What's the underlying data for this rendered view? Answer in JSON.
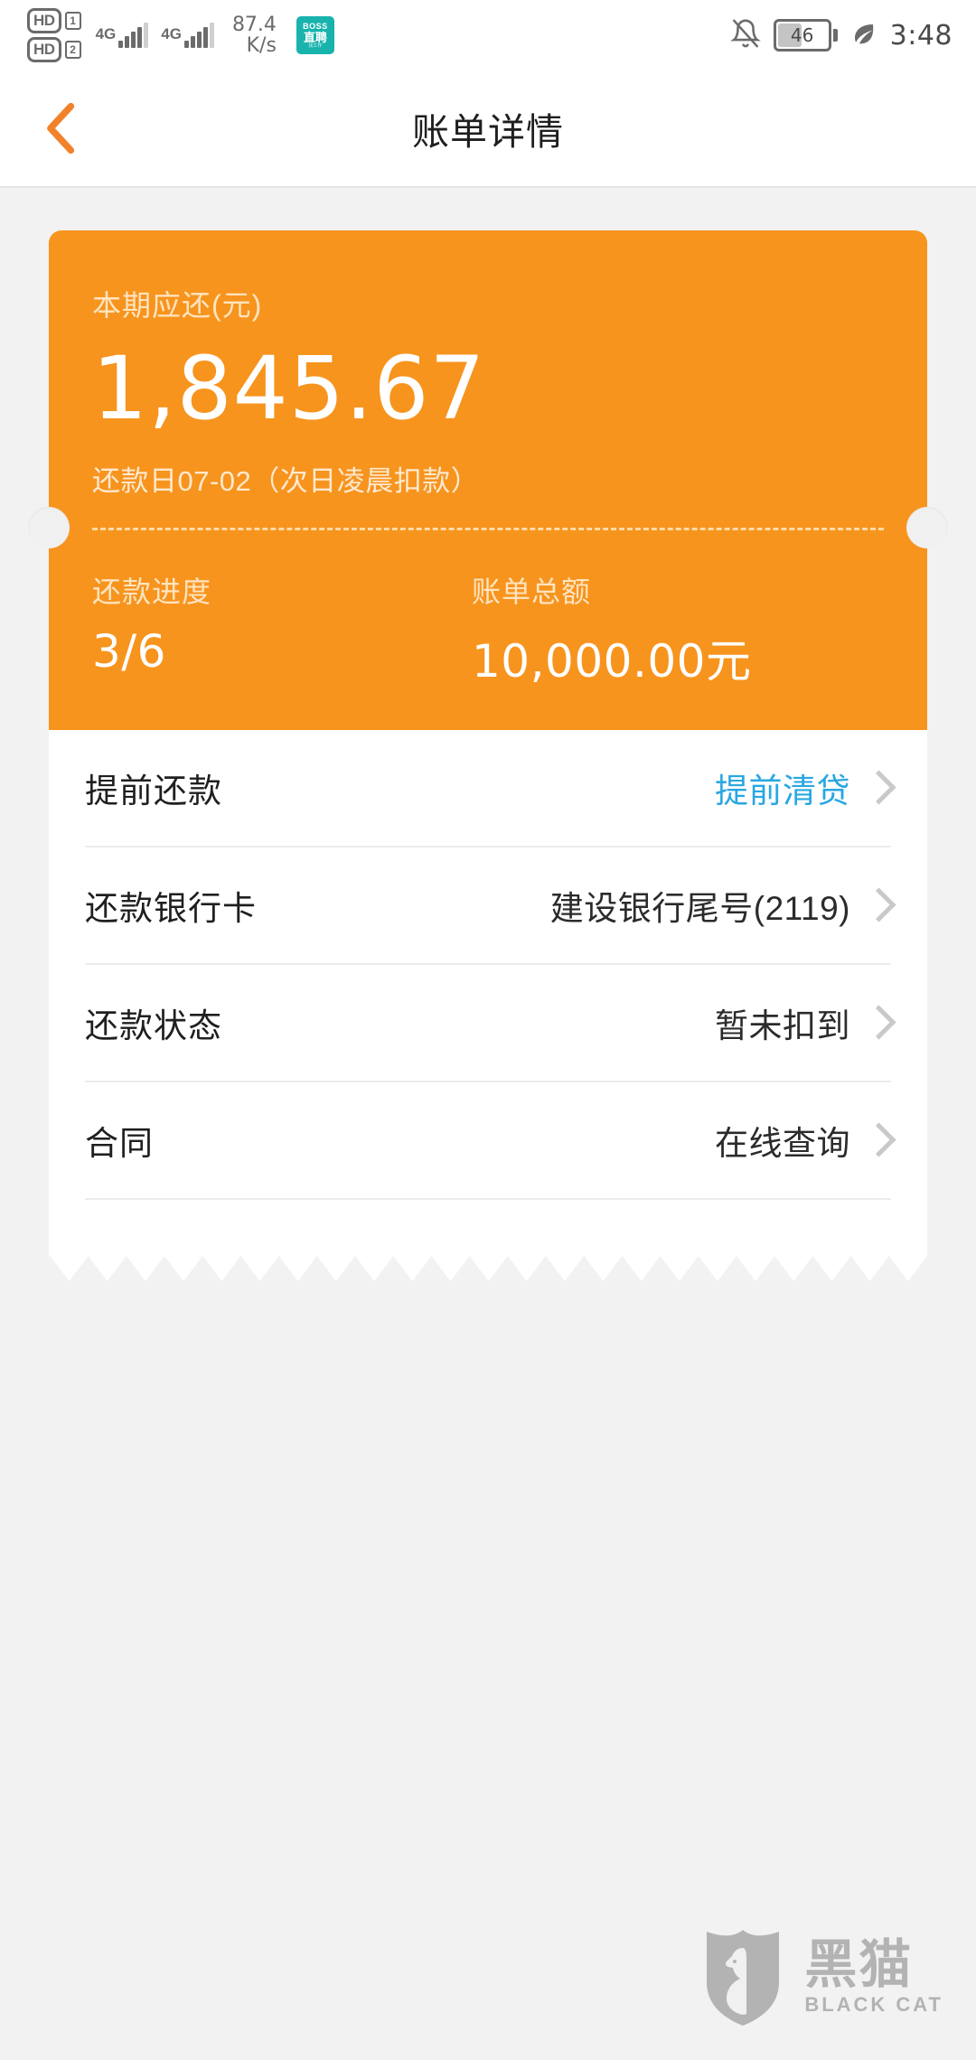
{
  "status_bar": {
    "hd_badge_1": "HD",
    "sim_1": "1",
    "hd_badge_2": "HD",
    "sim_2": "2",
    "network_1": "4G",
    "network_2": "4G",
    "net_speed_value": "87.4",
    "net_speed_unit": "K/s",
    "app_badge_line1": "BOSS",
    "app_badge_line2": "直聘",
    "app_badge_line3": "找工作",
    "battery_level": "46",
    "time": "3:48",
    "icons": {
      "bell": "bell-muted-icon",
      "battery": "battery-icon",
      "leaf": "power-saving-leaf-icon"
    }
  },
  "header": {
    "title": "账单详情",
    "back_icon": "back-chevron-icon"
  },
  "bill_card": {
    "due_label": "本期应还(元)",
    "due_amount": "1,845.67",
    "due_date_note": "还款日07-02（次日凌晨扣款）",
    "stats": [
      {
        "label": "还款进度",
        "value": "3/6"
      },
      {
        "label": "账单总额",
        "value": "10,000.00元"
      }
    ]
  },
  "detail_rows": [
    {
      "label": "提前还款",
      "value": "提前清贷",
      "is_link": true
    },
    {
      "label": "还款银行卡",
      "value": "建设银行尾号(2119)",
      "is_link": false
    },
    {
      "label": "还款状态",
      "value": "暂未扣到",
      "is_link": false
    },
    {
      "label": "合同",
      "value": "在线查询",
      "is_link": false
    }
  ],
  "watermark": {
    "cn": "黑猫",
    "en": "BLACK CAT",
    "logo_icon": "black-cat-shield-logo"
  },
  "colors": {
    "brand_orange": "#f7941e",
    "link_blue": "#29a7e1",
    "page_bg": "#f2f2f2",
    "card_white": "#ffffff"
  }
}
